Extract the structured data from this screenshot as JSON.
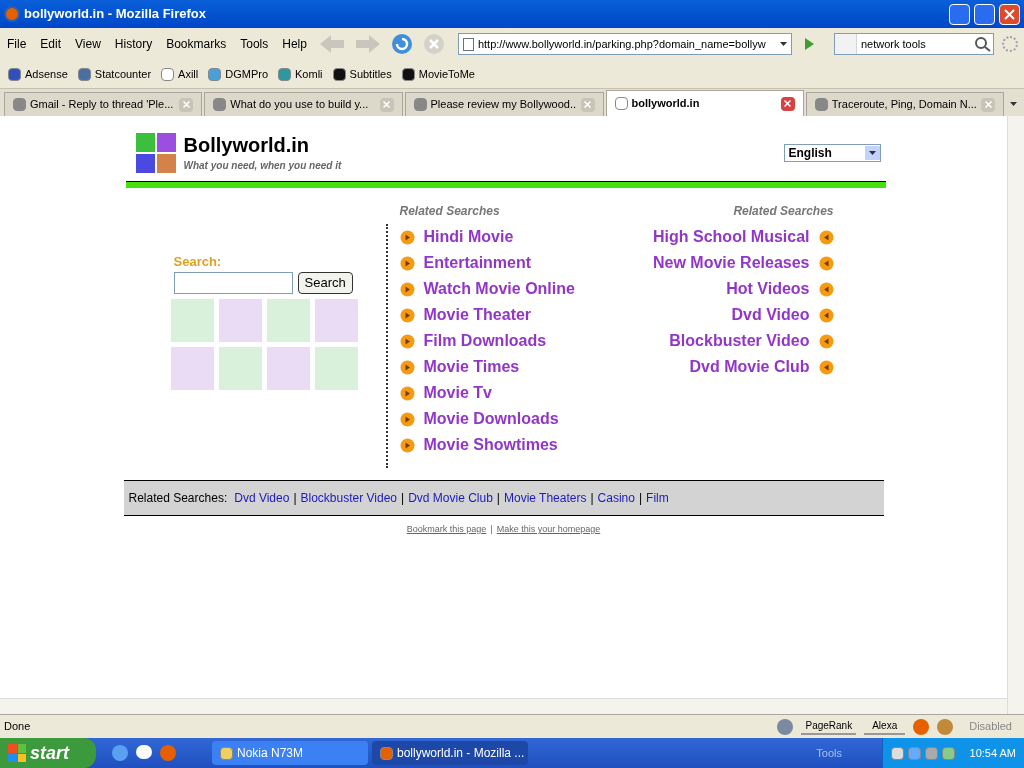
{
  "window": {
    "title": "bollyworld.in - Mozilla Firefox"
  },
  "menu": [
    "File",
    "Edit",
    "View",
    "History",
    "Bookmarks",
    "Tools",
    "Help"
  ],
  "address": {
    "value": "http://www.bollyworld.in/parking.php?domain_name=bollyw"
  },
  "web_search": {
    "value": "network tools"
  },
  "bookmarks": [
    "Adsense",
    "Statcounter",
    "Axill",
    "DGMPro",
    "Komli",
    "Subtitles",
    "MovieToMe"
  ],
  "tabs": [
    {
      "label": "Gmail - Reply to thread 'Ple...",
      "selected": false
    },
    {
      "label": "What do you use to build y...",
      "selected": false
    },
    {
      "label": "Please review my Bollywood...",
      "selected": false
    },
    {
      "label": "bollyworld.in",
      "selected": true
    },
    {
      "label": "Traceroute, Ping, Domain N...",
      "selected": false
    }
  ],
  "page": {
    "site_title": "Bollyworld.in",
    "tagline": "What you need, when you need it",
    "language": "English",
    "search_label": "Search:",
    "search_button": "Search",
    "left_heading": "Related Searches",
    "left_links": [
      "Hindi Movie",
      "Entertainment",
      "Watch Movie Online",
      "Movie Theater",
      "Film Downloads",
      "Movie Times",
      "Movie Tv",
      "Movie Downloads",
      "Movie Showtimes"
    ],
    "right_heading": "Related Searches",
    "right_links": [
      "High School Musical",
      "New Movie Releases",
      "Hot Videos",
      "Dvd Video",
      "Blockbuster Video",
      "Dvd Movie Club"
    ],
    "bar_label": "Related Searches:",
    "bar_links": [
      {
        "kind": "link",
        "text": "Dvd Video"
      },
      {
        "kind": "separator",
        "text": "|"
      },
      {
        "kind": "link",
        "text": "Blockbuster Video"
      },
      {
        "kind": "separator",
        "text": "|"
      },
      {
        "kind": "link",
        "text": "Dvd Movie Club"
      },
      {
        "kind": "separator",
        "text": "|"
      },
      {
        "kind": "link",
        "text": "Movie Theaters"
      },
      {
        "kind": "separator",
        "text": "|"
      },
      {
        "kind": "link",
        "text": "Casino"
      },
      {
        "kind": "separator",
        "text": "|"
      },
      {
        "kind": "link",
        "text": "Film"
      }
    ],
    "footer_links": [
      {
        "kind": "link",
        "text": "Bookmark this page"
      },
      {
        "kind": "separator",
        "text": "|"
      },
      {
        "kind": "link",
        "text": "Make this your homepage"
      }
    ]
  },
  "status_bar": {
    "text": "Done",
    "pagerank": "PageRank",
    "alexa": "Alexa",
    "disabled": "Disabled"
  },
  "taskbar": {
    "start": "start",
    "tasks": [
      {
        "label": "Nokia N73M",
        "selected": false
      },
      {
        "label": "bollyworld.in - Mozilla ...",
        "selected": true
      }
    ],
    "tools": "Tools",
    "clock": "10:54 AM"
  }
}
